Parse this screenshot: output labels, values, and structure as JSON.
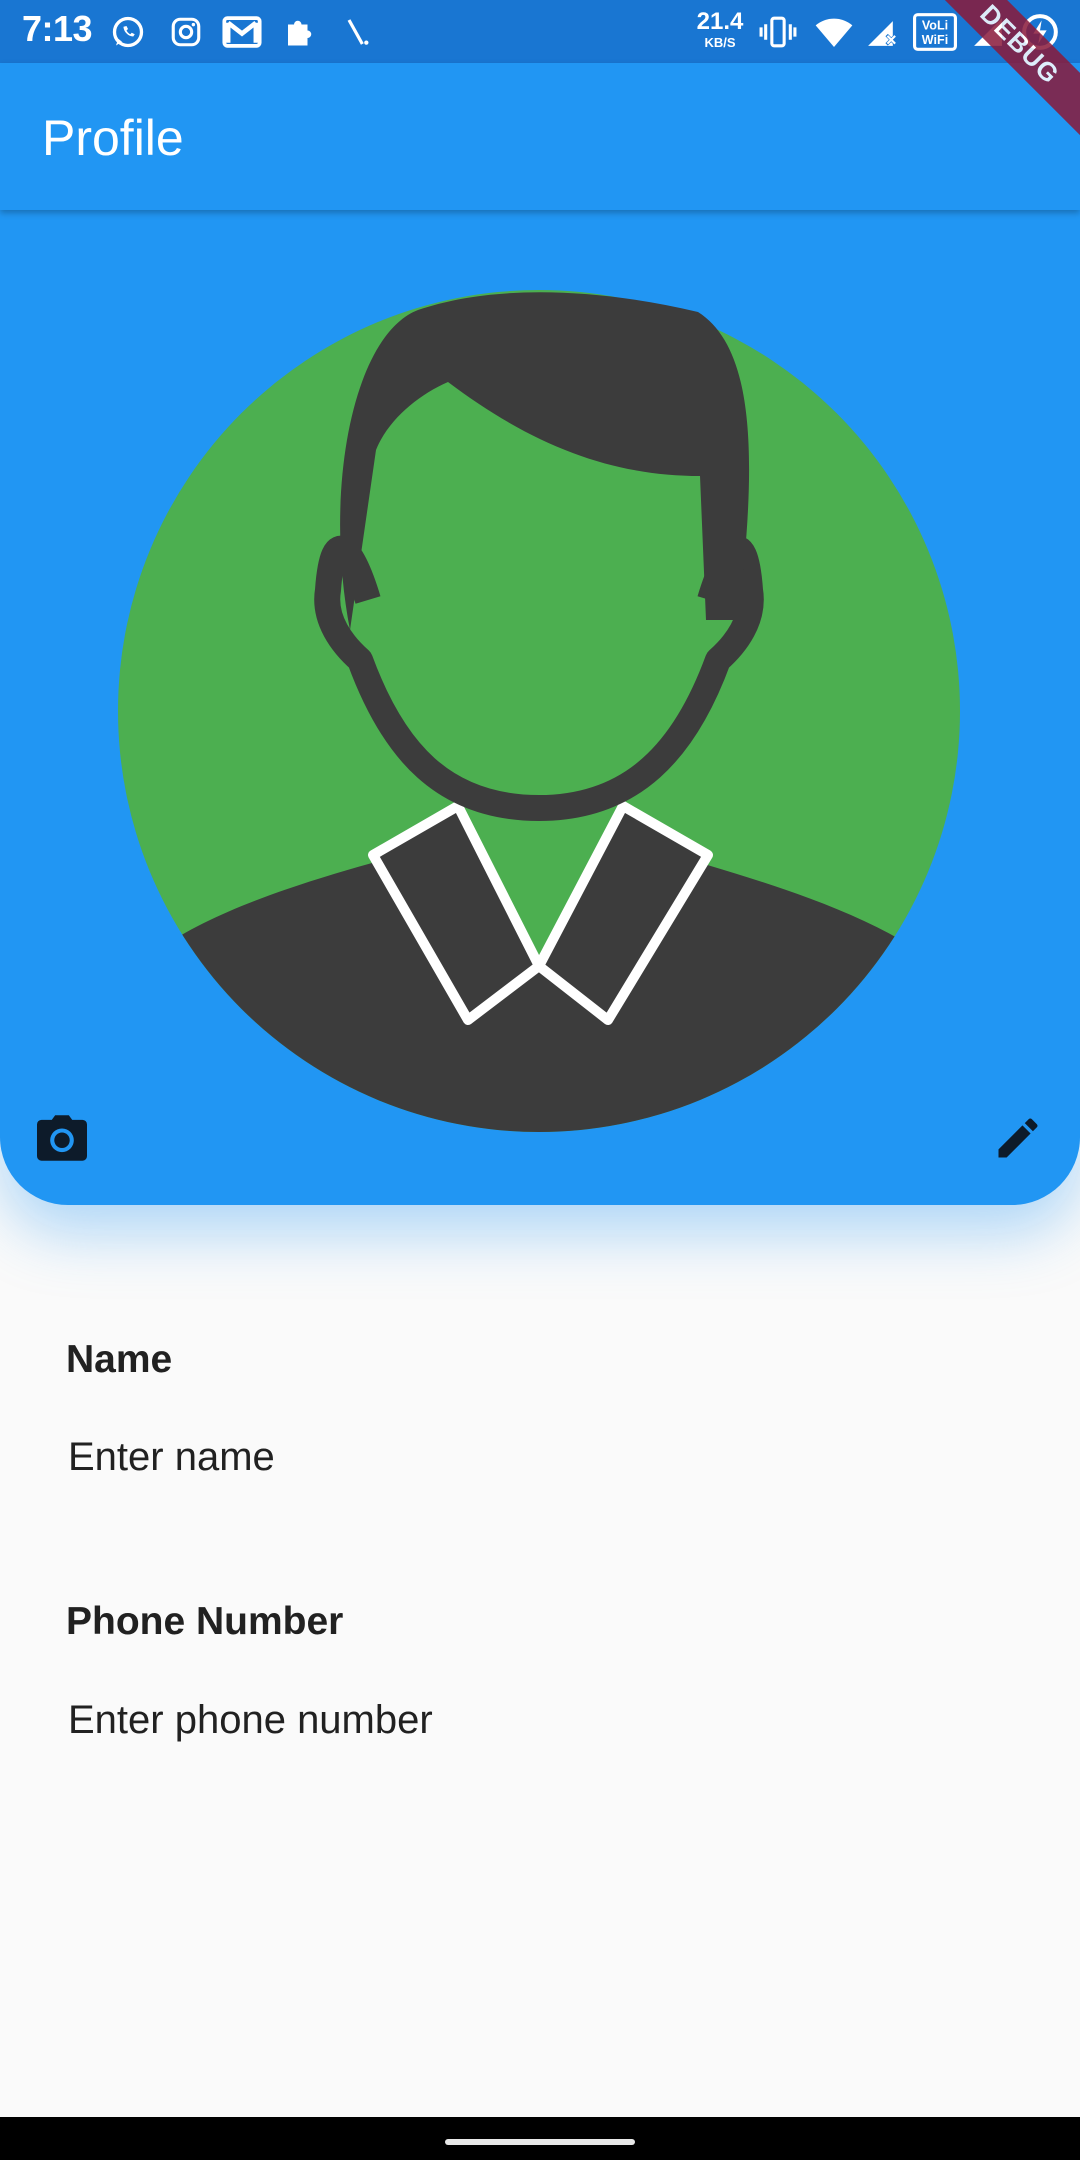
{
  "status_bar": {
    "time": "7:13",
    "net_speed_value": "21.4",
    "net_speed_unit": "KB/S",
    "left_icons": [
      "whatsapp-icon",
      "instagram-icon",
      "gmail-icon",
      "puzzle-icon",
      "signal-slash-icon"
    ],
    "right_icons": [
      "vibrate-icon",
      "wifi-icon",
      "cell-signal-x-icon",
      "vowifi-icon",
      "cell-signal-icon",
      "battery-charging-icon"
    ],
    "vowifi_text": "Vo WiFi"
  },
  "debug_banner": "DEBUG",
  "app_bar": {
    "title": "Profile"
  },
  "colors": {
    "primary": "#2196f3",
    "status_bar": "#1976d2",
    "avatar_background": "#4caf50",
    "avatar_figure": "#3c3c3c",
    "icon_dark": "#0d1b2a"
  },
  "profile": {
    "avatar_icon": "user-avatar-icon",
    "camera_icon": "camera-icon",
    "edit_icon": "pencil-icon"
  },
  "form": {
    "name": {
      "label": "Name",
      "placeholder": "Enter name",
      "value": ""
    },
    "phone": {
      "label": "Phone Number",
      "placeholder": "Enter phone number",
      "value": ""
    }
  }
}
